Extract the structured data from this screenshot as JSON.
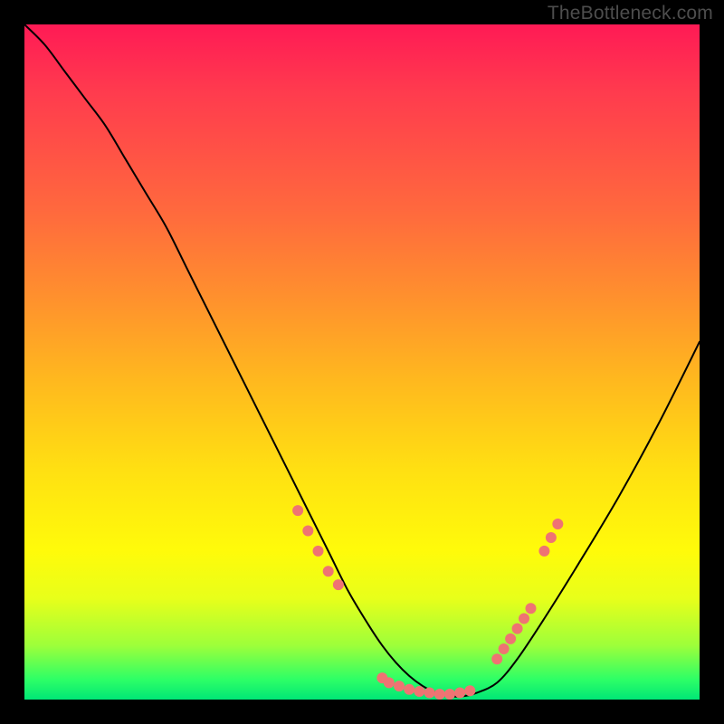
{
  "watermark": "TheBottleneck.com",
  "colors": {
    "page_bg": "#000000",
    "curve": "#000000",
    "marker": "#ef7373",
    "gradient_stops": [
      "#ff1a55",
      "#ff6a3d",
      "#ffb61f",
      "#fffb0a",
      "#9dff3a",
      "#00e676"
    ]
  },
  "chart_data": {
    "type": "line",
    "title": "",
    "xlabel": "",
    "ylabel": "",
    "xlim": [
      0,
      100
    ],
    "ylim": [
      0,
      100
    ],
    "series": [
      {
        "name": "bottleneck-curve",
        "x": [
          0,
          3,
          6,
          9,
          12,
          15,
          18,
          21,
          24,
          27,
          30,
          33,
          36,
          39,
          42,
          45,
          48,
          51,
          53,
          55,
          57,
          59,
          61,
          63,
          65,
          67,
          70,
          73,
          77,
          82,
          88,
          94,
          100
        ],
        "y": [
          100,
          97,
          93,
          89,
          85,
          80,
          75,
          70,
          64,
          58,
          52,
          46,
          40,
          34,
          28,
          22,
          16,
          11,
          8,
          5.5,
          3.5,
          2,
          1,
          0.5,
          0.5,
          1,
          2.5,
          6,
          12,
          20,
          30,
          41,
          53
        ]
      }
    ],
    "markers": {
      "name": "highlight-points",
      "groups": [
        {
          "x": [
            40.5,
            42,
            43.5,
            45,
            46.5
          ],
          "y": [
            28,
            25,
            22,
            19,
            17
          ]
        },
        {
          "x": [
            53,
            54,
            55.5,
            57,
            58.5,
            60,
            61.5,
            63,
            64.5,
            66
          ],
          "y": [
            3.2,
            2.5,
            2.0,
            1.5,
            1.2,
            1.0,
            0.8,
            0.8,
            1.0,
            1.3
          ]
        },
        {
          "x": [
            70,
            71,
            72,
            73,
            74,
            75
          ],
          "y": [
            6,
            7.5,
            9,
            10.5,
            12,
            13.5
          ]
        },
        {
          "x": [
            77,
            78,
            79
          ],
          "y": [
            22,
            24,
            26
          ]
        }
      ]
    }
  }
}
